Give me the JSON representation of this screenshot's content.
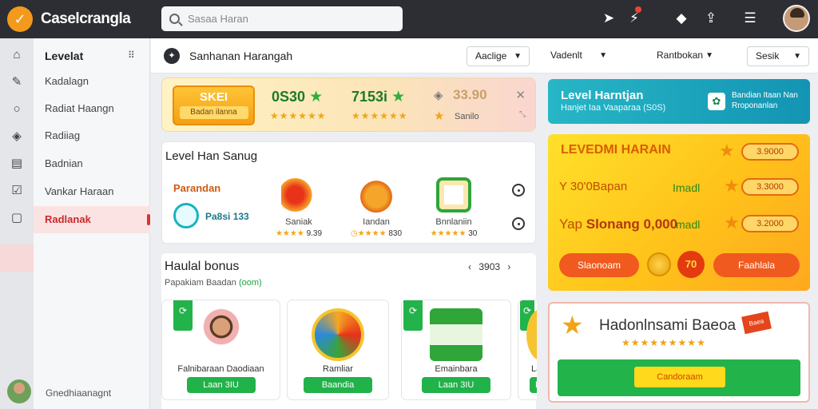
{
  "app": {
    "title": "Caselcrangla",
    "search_placeholder": "Sasaa Haran"
  },
  "topbar_icons": [
    "rocket-icon",
    "bolt-icon",
    "cube-icon",
    "share-icon",
    "clipboard-icon"
  ],
  "sidebar": {
    "header": "Levelat",
    "items": [
      {
        "label": "Kadalagn"
      },
      {
        "label": "Radiat Haangn"
      },
      {
        "label": "Radiiag"
      },
      {
        "label": "Badnian"
      },
      {
        "label": "Vankar Haraan"
      },
      {
        "label": "Radlanak",
        "active": true
      }
    ],
    "footer_label": "Gnedhiaanagnt"
  },
  "header": {
    "title": "Sanhanan Harangah",
    "dropdowns": [
      "Aaclige",
      "Vadenlt",
      "Rantbokan",
      "Sesik"
    ]
  },
  "stats": {
    "badge_top": "SKEI",
    "badge_bottom": "Badan ilanna",
    "value1": "0S30",
    "value2": "7153i",
    "value3": "33.90",
    "value3_label": "Sanilo"
  },
  "level_card": {
    "title": "Level Han Sanug",
    "subtitle": "Parandan",
    "pill_text": "Pa8si 133",
    "products": [
      {
        "name": "Saniak",
        "rating": "9.39"
      },
      {
        "name": "Iandan",
        "rating": "830"
      },
      {
        "name": "Bnnlaniin",
        "rating": "30"
      }
    ]
  },
  "bonus": {
    "title": "Haulal bonus",
    "subtitle_prefix": "Papakiam Baadan",
    "subtitle_highlight": "(oom)",
    "pager": "3903",
    "cards": [
      {
        "name": "Falnibaraan Daodiaan",
        "button": "Laan 3IU"
      },
      {
        "name": "Ramliar",
        "button": "Baandia"
      },
      {
        "name": "Emainbara",
        "button": "Laan 3IU"
      },
      {
        "name": "Lan",
        "button": "L"
      }
    ]
  },
  "promo": {
    "title": "Level Harntjan",
    "subtitle": "Hanjet Iaa Vaaparaa (S0S)",
    "side_text": "Bandian Itaan Nan Rroponanlan"
  },
  "yellow_panel": {
    "title": "LEVEDMI HARAIN",
    "line1": "Y 30'0Bapan",
    "line1_right": "Imadl",
    "line2_prefix": "Yap",
    "line2_main": "Slonang 0,000",
    "line2_suffix": "madl",
    "pills": [
      "3.9000",
      "3.3000",
      "3.2000"
    ],
    "button1": "Slaonoam",
    "badge_num": "70",
    "button2": "Faahlala"
  },
  "bonus_box": {
    "title": "Hadonlnsami Baeoa",
    "ribbon": "Baea",
    "stars": "★★★★★★★★★",
    "button": "Candoraam"
  }
}
